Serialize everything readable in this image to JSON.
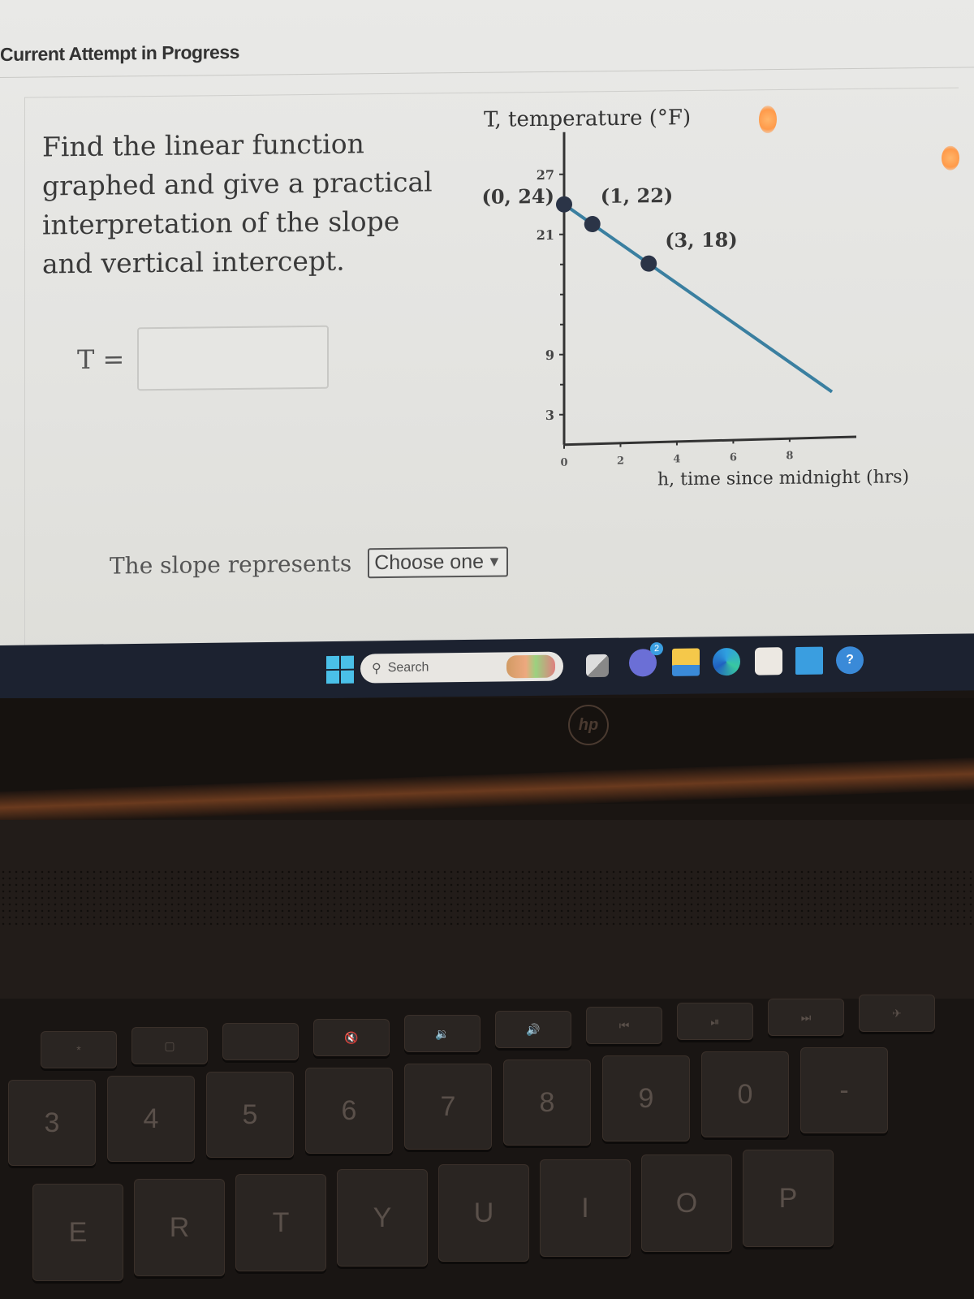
{
  "header": {
    "status": "Current Attempt in Progress"
  },
  "question": {
    "text": "Find the linear function graphed and give a practical interpretation of the slope and vertical intercept.",
    "equation_label": "T =",
    "equation_value": "",
    "slope_label": "The slope represents",
    "slope_select": {
      "selected": "Choose one",
      "arrow": "▼"
    }
  },
  "chart_data": {
    "type": "line",
    "ylabel": "T, temperature (°F)",
    "xlabel": "h, time since midnight (hrs)",
    "x_ticks": [
      0,
      2,
      4,
      6,
      8
    ],
    "y_ticks": [
      3,
      9,
      21,
      27
    ],
    "y_minor_ticks": [
      6,
      12,
      15,
      18,
      24
    ],
    "xlim": [
      0,
      9.5
    ],
    "ylim": [
      0,
      30
    ],
    "line": {
      "x": [
        0,
        9.5
      ],
      "y": [
        24,
        5
      ],
      "color": "#3a7fa0"
    },
    "points": [
      {
        "x": 0,
        "y": 24,
        "label": "(0, 24)"
      },
      {
        "x": 1,
        "y": 22,
        "label": "(1, 22)"
      },
      {
        "x": 3,
        "y": 18,
        "label": "(3, 18)"
      }
    ],
    "point_color": "#2b3447",
    "grid": false
  },
  "taskbar": {
    "search_placeholder": "Search",
    "chat_badge": "2",
    "apps": [
      "start-icon",
      "task-view-icon",
      "teams-chat-icon",
      "file-explorer-icon",
      "edge-icon",
      "store-icon",
      "hp-app-icon",
      "help-icon"
    ]
  },
  "device": {
    "brand": "hp"
  },
  "keyboard": {
    "fn_row": [
      "*",
      "▢",
      "",
      "🔇",
      "🔉",
      "🔊",
      "⏮",
      "⏯",
      "⏭",
      "✈"
    ],
    "number_row": [
      "3",
      "4",
      "5",
      "6",
      "7",
      "8",
      "9",
      "0",
      "-"
    ],
    "letter_row": [
      "E",
      "R",
      "T",
      "Y",
      "U",
      "I",
      "O",
      "P"
    ]
  }
}
